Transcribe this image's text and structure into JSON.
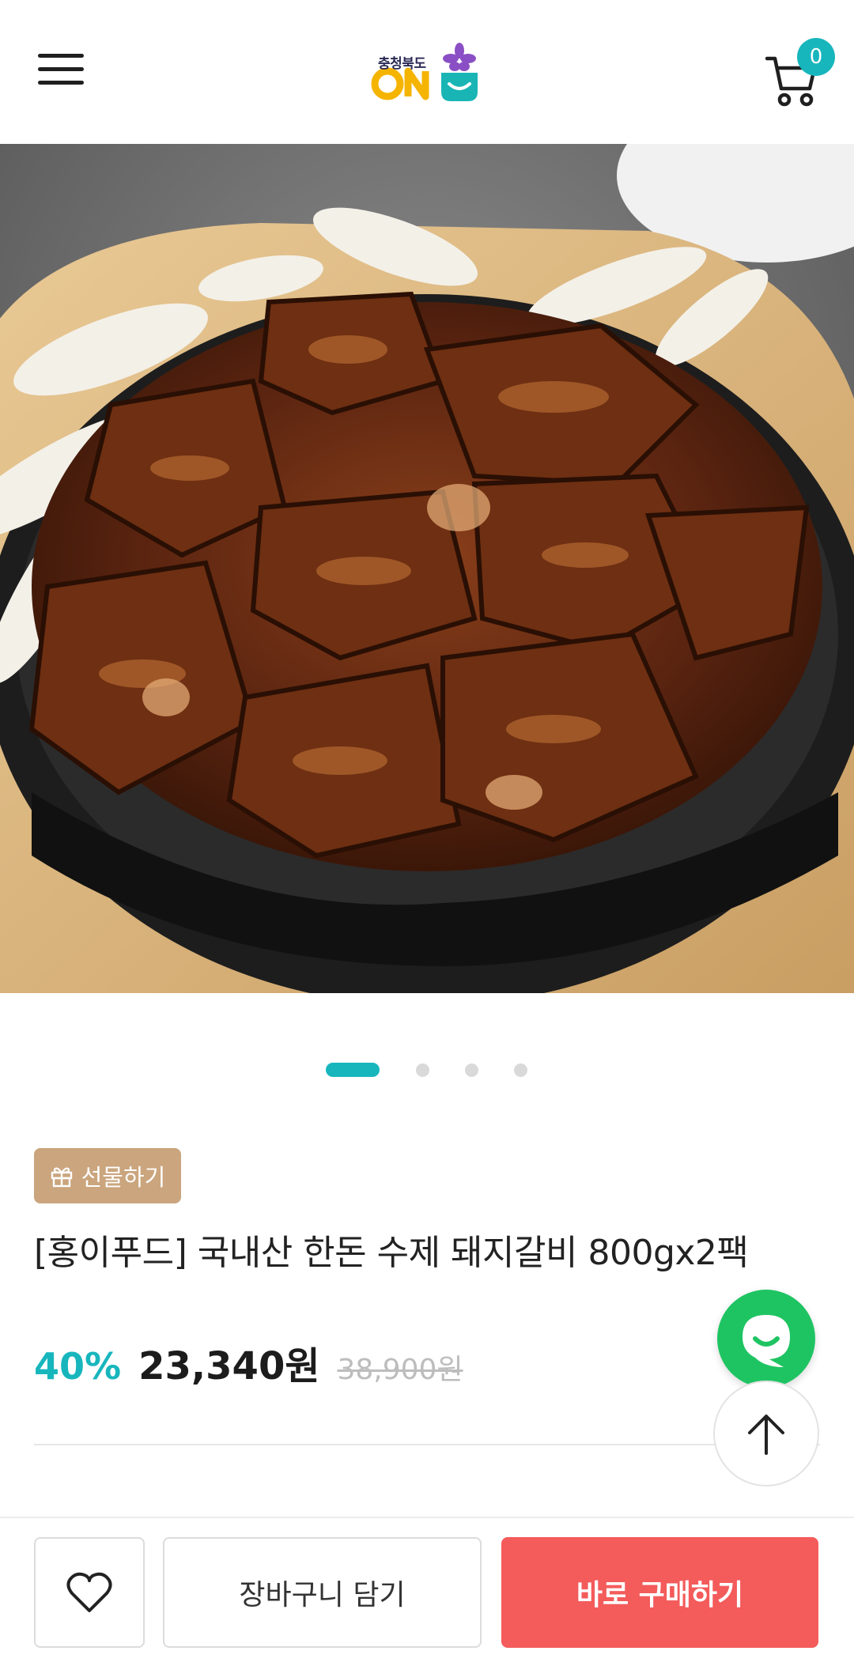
{
  "header": {
    "logo_region": "충청북도",
    "logo_mark": "ON",
    "cart_count": "0"
  },
  "hero": {
    "image_description": "grilled pork galbi on a hot plate with onions",
    "slide_count": 4,
    "active_slide": 1
  },
  "product": {
    "gift_label": "선물하기",
    "title": "[홍이푸드] 국내산 한돈 수제 돼지갈비 800gx2팩",
    "discount": "40%",
    "price": "23,340원",
    "original_price": "38,900원"
  },
  "bottom_bar": {
    "add_to_cart_label": "장바구니 담기",
    "buy_now_label": "바로 구매하기"
  },
  "colors": {
    "accent_teal": "#17b6bd",
    "buy_red": "#f45b5b",
    "gift_gold": "#caa57d",
    "talk_green": "#1fc462"
  },
  "icons": [
    "menu-icon",
    "cart-icon",
    "gift-icon",
    "chat-icon",
    "arrow-up-icon",
    "heart-icon"
  ]
}
